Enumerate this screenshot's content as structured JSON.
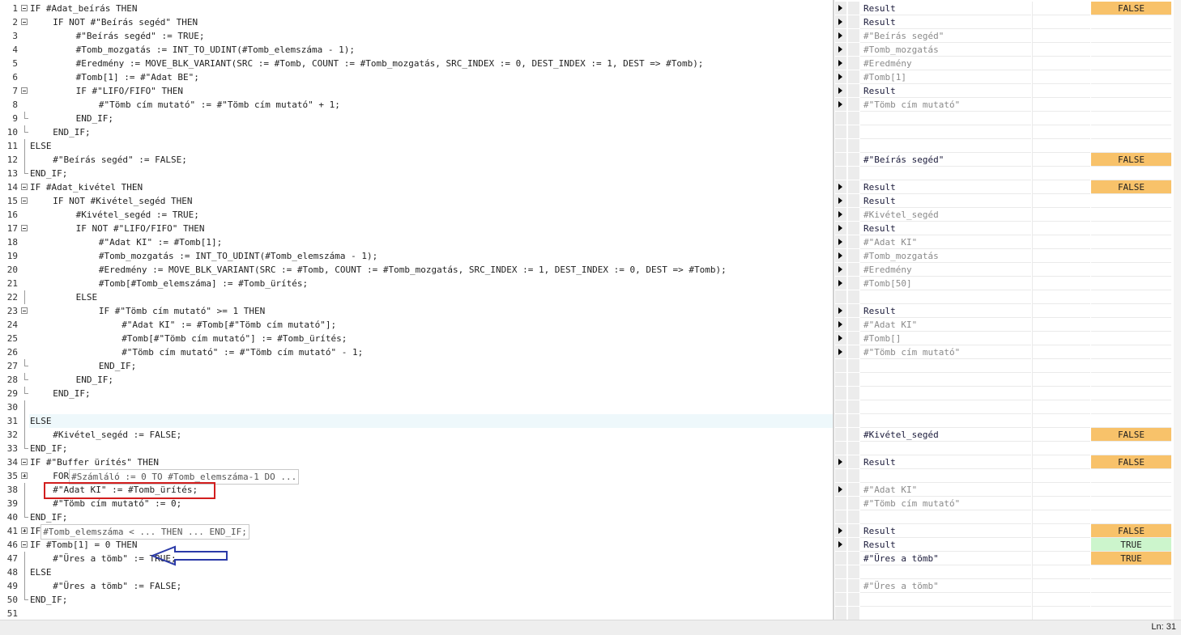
{
  "status": {
    "line_indicator": "Ln: 31"
  },
  "lines": [
    {
      "num": "1",
      "code": "IF #Adat_beírás THEN",
      "indent": 0,
      "fold": "minus",
      "arrow": true,
      "wname": "Result",
      "wstyle": "bold",
      "wval": "FALSE",
      "vstyle": "false"
    },
    {
      "num": "2",
      "code": "IF NOT #\"Beírás segéd\" THEN",
      "indent": 1,
      "fold": "minus",
      "arrow": true,
      "wname": "Result",
      "wstyle": "bold",
      "wval": "",
      "vstyle": ""
    },
    {
      "num": "3",
      "code": "#\"Beírás segéd\" := TRUE;",
      "indent": 2,
      "fold": "",
      "arrow": true,
      "wname": "#\"Beírás segéd\"",
      "wstyle": "gray",
      "wval": "",
      "vstyle": ""
    },
    {
      "num": "4",
      "code": "#Tomb_mozgatás := INT_TO_UDINT(#Tomb_elemszáma - 1);",
      "indent": 2,
      "fold": "",
      "arrow": true,
      "wname": "#Tomb_mozgatás",
      "wstyle": "gray",
      "wval": "",
      "vstyle": ""
    },
    {
      "num": "5",
      "code": "#Eredmény := MOVE_BLK_VARIANT(SRC := #Tomb, COUNT := #Tomb_mozgatás, SRC_INDEX := 0, DEST_INDEX := 1, DEST => #Tomb);",
      "indent": 2,
      "fold": "",
      "arrow": true,
      "wname": "#Eredmény",
      "wstyle": "gray",
      "wval": "",
      "vstyle": ""
    },
    {
      "num": "6",
      "code": "#Tomb[1] := #\"Adat BE\";",
      "indent": 2,
      "fold": "",
      "arrow": true,
      "wname": "#Tomb[1]",
      "wstyle": "gray",
      "wval": "",
      "vstyle": ""
    },
    {
      "num": "7",
      "code": "IF #\"LIFO/FIFO\" THEN",
      "indent": 2,
      "fold": "minus",
      "arrow": true,
      "wname": "Result",
      "wstyle": "bold",
      "wval": "",
      "vstyle": ""
    },
    {
      "num": "8",
      "code": "#\"Tömb cím mutató\" := #\"Tömb cím mutató\" + 1;",
      "indent": 3,
      "fold": "",
      "arrow": true,
      "wname": "#\"Tömb cím mutató\"",
      "wstyle": "gray",
      "wval": "",
      "vstyle": ""
    },
    {
      "num": "9",
      "code": "END_IF;",
      "indent": 2,
      "fold": "end",
      "arrow": false,
      "wname": "",
      "wstyle": "",
      "wval": "",
      "vstyle": ""
    },
    {
      "num": "10",
      "code": "END_IF;",
      "indent": 1,
      "fold": "end",
      "arrow": false,
      "wname": "",
      "wstyle": "",
      "wval": "",
      "vstyle": ""
    },
    {
      "num": "11",
      "code": "ELSE",
      "indent": 0,
      "fold": "guide",
      "arrow": false,
      "wname": "",
      "wstyle": "",
      "wval": "",
      "vstyle": ""
    },
    {
      "num": "12",
      "code": "#\"Beírás segéd\" := FALSE;",
      "indent": 1,
      "fold": "guide",
      "arrow": false,
      "wname": "#\"Beírás segéd\"",
      "wstyle": "bold",
      "wval": "FALSE",
      "vstyle": "false"
    },
    {
      "num": "13",
      "code": "END_IF;",
      "indent": 0,
      "fold": "end",
      "arrow": false,
      "wname": "",
      "wstyle": "",
      "wval": "",
      "vstyle": ""
    },
    {
      "num": "14",
      "code": "IF #Adat_kivétel THEN",
      "indent": 0,
      "fold": "minus",
      "arrow": true,
      "wname": "Result",
      "wstyle": "bold",
      "wval": "FALSE",
      "vstyle": "false"
    },
    {
      "num": "15",
      "code": "IF NOT #Kivétel_segéd THEN",
      "indent": 1,
      "fold": "minus",
      "arrow": true,
      "wname": "Result",
      "wstyle": "bold",
      "wval": "",
      "vstyle": ""
    },
    {
      "num": "16",
      "code": "#Kivétel_segéd := TRUE;",
      "indent": 2,
      "fold": "",
      "arrow": true,
      "wname": "#Kivétel_segéd",
      "wstyle": "gray",
      "wval": "",
      "vstyle": ""
    },
    {
      "num": "17",
      "code": "IF NOT #\"LIFO/FIFO\" THEN",
      "indent": 2,
      "fold": "minus",
      "arrow": true,
      "wname": "Result",
      "wstyle": "bold",
      "wval": "",
      "vstyle": ""
    },
    {
      "num": "18",
      "code": "#\"Adat KI\" := #Tomb[1];",
      "indent": 3,
      "fold": "",
      "arrow": true,
      "wname": "#\"Adat KI\"",
      "wstyle": "gray",
      "wval": "",
      "vstyle": ""
    },
    {
      "num": "19",
      "code": "#Tomb_mozgatás := INT_TO_UDINT(#Tomb_elemszáma - 1);",
      "indent": 3,
      "fold": "",
      "arrow": true,
      "wname": "#Tomb_mozgatás",
      "wstyle": "gray",
      "wval": "",
      "vstyle": ""
    },
    {
      "num": "20",
      "code": "#Eredmény := MOVE_BLK_VARIANT(SRC := #Tomb, COUNT := #Tomb_mozgatás, SRC_INDEX := 1, DEST_INDEX := 0, DEST => #Tomb);",
      "indent": 3,
      "fold": "",
      "arrow": true,
      "wname": "#Eredmény",
      "wstyle": "gray",
      "wval": "",
      "vstyle": ""
    },
    {
      "num": "21",
      "code": "#Tomb[#Tomb_elemszáma] := #Tomb_ürítés;",
      "indent": 3,
      "fold": "",
      "arrow": true,
      "wname": "#Tomb[50]",
      "wstyle": "gray",
      "wval": "",
      "vstyle": ""
    },
    {
      "num": "22",
      "code": "ELSE",
      "indent": 2,
      "fold": "guide",
      "arrow": false,
      "wname": "",
      "wstyle": "",
      "wval": "",
      "vstyle": ""
    },
    {
      "num": "23",
      "code": "IF #\"Tömb cím mutató\" >= 1 THEN",
      "indent": 3,
      "fold": "minus",
      "arrow": true,
      "wname": "Result",
      "wstyle": "bold",
      "wval": "",
      "vstyle": ""
    },
    {
      "num": "24",
      "code": "#\"Adat KI\" := #Tomb[#\"Tömb cím mutató\"];",
      "indent": 4,
      "fold": "",
      "arrow": true,
      "wname": "#\"Adat KI\"",
      "wstyle": "gray",
      "wval": "",
      "vstyle": ""
    },
    {
      "num": "25",
      "code": "#Tomb[#\"Tömb cím mutató\"] := #Tomb_ürítés;",
      "indent": 4,
      "fold": "",
      "arrow": true,
      "wname": "#Tomb[]",
      "wstyle": "gray",
      "wval": "",
      "vstyle": ""
    },
    {
      "num": "26",
      "code": "#\"Tömb cím mutató\" := #\"Tömb cím mutató\" - 1;",
      "indent": 4,
      "fold": "",
      "arrow": true,
      "wname": "#\"Tömb cím mutató\"",
      "wstyle": "gray",
      "wval": "",
      "vstyle": ""
    },
    {
      "num": "27",
      "code": "END_IF;",
      "indent": 3,
      "fold": "end",
      "arrow": false,
      "wname": "",
      "wstyle": "",
      "wval": "",
      "vstyle": ""
    },
    {
      "num": "28",
      "code": "END_IF;",
      "indent": 2,
      "fold": "end",
      "arrow": false,
      "wname": "",
      "wstyle": "",
      "wval": "",
      "vstyle": ""
    },
    {
      "num": "29",
      "code": "END_IF;",
      "indent": 1,
      "fold": "end",
      "arrow": false,
      "wname": "",
      "wstyle": "",
      "wval": "",
      "vstyle": ""
    },
    {
      "num": "30",
      "code": "",
      "indent": 0,
      "fold": "guide",
      "arrow": false,
      "wname": "",
      "wstyle": "",
      "wval": "",
      "vstyle": ""
    },
    {
      "num": "31",
      "code": "ELSE",
      "indent": 0,
      "fold": "guide",
      "arrow": false,
      "wname": "",
      "wstyle": "",
      "wval": "",
      "vstyle": "",
      "highlight": true
    },
    {
      "num": "32",
      "code": "#Kivétel_segéd := FALSE;",
      "indent": 1,
      "fold": "guide",
      "arrow": false,
      "wname": "#Kivétel_segéd",
      "wstyle": "bold",
      "wval": "FALSE",
      "vstyle": "false"
    },
    {
      "num": "33",
      "code": "END_IF;",
      "indent": 0,
      "fold": "end",
      "arrow": false,
      "wname": "",
      "wstyle": "",
      "wval": "",
      "vstyle": ""
    },
    {
      "num": "34",
      "code": "IF #\"Buffer ürítés\" THEN",
      "indent": 0,
      "fold": "minus",
      "arrow": true,
      "wname": "Result",
      "wstyle": "bold",
      "wval": "FALSE",
      "vstyle": "false"
    },
    {
      "num": "35",
      "code": "FOR",
      "indent": 1,
      "fold": "plus",
      "arrow": false,
      "wname": "",
      "wstyle": "",
      "wval": "",
      "vstyle": "",
      "folded": "#Számláló := 0 TO #Tomb_elemszáma-1 DO ..."
    },
    {
      "num": "38",
      "code": "#\"Adat KI\" := #Tomb_ürítés;",
      "indent": 1,
      "fold": "guide",
      "arrow": true,
      "wname": "#\"Adat KI\"",
      "wstyle": "gray",
      "wval": "",
      "vstyle": ""
    },
    {
      "num": "39",
      "code": "#\"Tömb cím mutató\" := 0;",
      "indent": 1,
      "fold": "guide",
      "arrow": false,
      "wname": "#\"Tömb cím mutató\"",
      "wstyle": "gray",
      "wval": "",
      "vstyle": ""
    },
    {
      "num": "40",
      "code": "END_IF;",
      "indent": 0,
      "fold": "end",
      "arrow": false,
      "wname": "",
      "wstyle": "",
      "wval": "",
      "vstyle": ""
    },
    {
      "num": "41",
      "code": "IF",
      "indent": 0,
      "fold": "plus",
      "arrow": true,
      "wname": "Result",
      "wstyle": "bold",
      "wval": "FALSE",
      "vstyle": "false",
      "folded": "#Tomb_elemszáma < ... THEN ... END_IF;"
    },
    {
      "num": "46",
      "code": "IF #Tomb[1] = 0 THEN",
      "indent": 0,
      "fold": "minus",
      "arrow": true,
      "wname": "Result",
      "wstyle": "bold",
      "wval": "TRUE",
      "vstyle": "true-green"
    },
    {
      "num": "47",
      "code": "#\"Üres a tömb\" := TRUE;",
      "indent": 1,
      "fold": "guide",
      "arrow": false,
      "wname": "#\"Üres a tömb\"",
      "wstyle": "bold",
      "wval": "TRUE",
      "vstyle": "true-orange"
    },
    {
      "num": "48",
      "code": "ELSE",
      "indent": 0,
      "fold": "guide",
      "arrow": false,
      "wname": "",
      "wstyle": "",
      "wval": "",
      "vstyle": ""
    },
    {
      "num": "49",
      "code": "#\"Üres a tömb\" := FALSE;",
      "indent": 1,
      "fold": "guide",
      "arrow": false,
      "wname": "#\"Üres a tömb\"",
      "wstyle": "gray",
      "wval": "",
      "vstyle": ""
    },
    {
      "num": "50",
      "code": "END_IF;",
      "indent": 0,
      "fold": "end",
      "arrow": false,
      "wname": "",
      "wstyle": "",
      "wval": "",
      "vstyle": ""
    },
    {
      "num": "51",
      "code": "",
      "indent": 0,
      "fold": "",
      "arrow": false,
      "wname": "",
      "wstyle": "",
      "wval": "",
      "vstyle": ""
    }
  ]
}
